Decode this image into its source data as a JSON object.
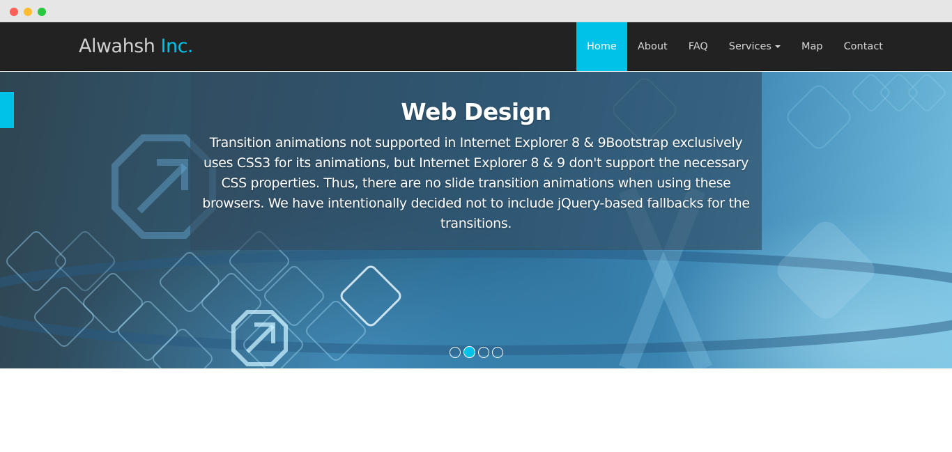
{
  "window": {
    "controls": [
      "close",
      "minimize",
      "maximize"
    ]
  },
  "brand": {
    "name": "Alwahsh",
    "suffix": "Inc."
  },
  "nav": {
    "items": [
      {
        "label": "Home",
        "active": true
      },
      {
        "label": "About",
        "active": false
      },
      {
        "label": "FAQ",
        "active": false
      },
      {
        "label": "Services",
        "active": false,
        "dropdown": true
      },
      {
        "label": "Map",
        "active": false
      },
      {
        "label": "Contact",
        "active": false
      }
    ]
  },
  "carousel": {
    "title": "Web Design",
    "text": "Transition animations not supported in Internet Explorer 8 & 9Bootstrap exclusively uses CSS3 for its animations, but Internet Explorer 8 & 9 don't support the necessary CSS properties. Thus, there are no slide transition animations when using these browsers. We have intentionally decided not to include jQuery-based fallbacks for the transitions.",
    "slide_count": 4,
    "active_slide": 2
  },
  "colors": {
    "accent": "#00c2e8",
    "navbar_bg": "#222222",
    "close": "#ff5f57",
    "minimize": "#febc2e",
    "maximize": "#28c840"
  }
}
